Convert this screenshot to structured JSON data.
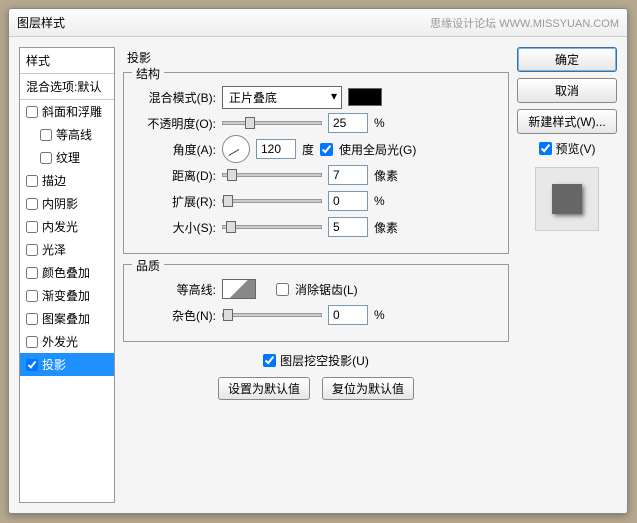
{
  "titlebar": {
    "title": "图层样式",
    "watermark": "思缘设计论坛  WWW.MISSYUAN.COM"
  },
  "left": {
    "header": "样式",
    "blend": "混合选项:默认",
    "items": [
      {
        "label": "斜面和浮雕",
        "checked": false,
        "indent": false
      },
      {
        "label": "等高线",
        "checked": false,
        "indent": true
      },
      {
        "label": "纹理",
        "checked": false,
        "indent": true
      },
      {
        "label": "描边",
        "checked": false,
        "indent": false
      },
      {
        "label": "内阴影",
        "checked": false,
        "indent": false
      },
      {
        "label": "内发光",
        "checked": false,
        "indent": false
      },
      {
        "label": "光泽",
        "checked": false,
        "indent": false
      },
      {
        "label": "颜色叠加",
        "checked": false,
        "indent": false
      },
      {
        "label": "渐变叠加",
        "checked": false,
        "indent": false
      },
      {
        "label": "图案叠加",
        "checked": false,
        "indent": false
      },
      {
        "label": "外发光",
        "checked": false,
        "indent": false
      },
      {
        "label": "投影",
        "checked": true,
        "indent": false,
        "selected": true
      }
    ]
  },
  "mid": {
    "section_title": "投影",
    "structure": {
      "legend": "结构",
      "blend_label": "混合模式(B):",
      "blend_value": "正片叠底",
      "opacity_label": "不透明度(O):",
      "opacity_value": "25",
      "opacity_unit": "%",
      "angle_label": "角度(A):",
      "angle_value": "120",
      "angle_unit": "度",
      "global_light": "使用全局光(G)",
      "global_checked": true,
      "distance_label": "距离(D):",
      "distance_value": "7",
      "distance_unit": "像素",
      "spread_label": "扩展(R):",
      "spread_value": "0",
      "spread_unit": "%",
      "size_label": "大小(S):",
      "size_value": "5",
      "size_unit": "像素"
    },
    "quality": {
      "legend": "品质",
      "contour_label": "等高线:",
      "antialias": "消除锯齿(L)",
      "antialias_checked": false,
      "noise_label": "杂色(N):",
      "noise_value": "0",
      "noise_unit": "%"
    },
    "knockout": "图层挖空投影(U)",
    "knockout_checked": true,
    "defaults": {
      "set": "设置为默认值",
      "reset": "复位为默认值"
    }
  },
  "right": {
    "ok": "确定",
    "cancel": "取消",
    "newstyle": "新建样式(W)...",
    "preview_label": "预览(V)",
    "preview_checked": true
  }
}
